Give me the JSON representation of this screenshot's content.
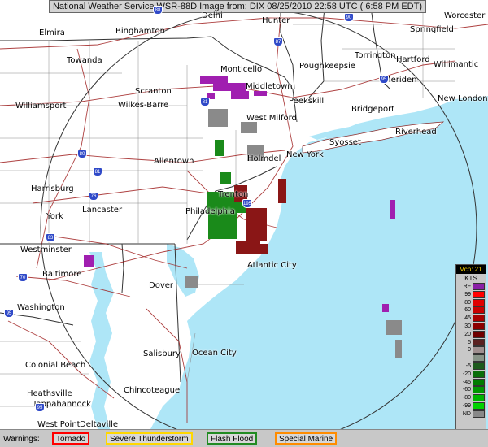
{
  "title": "National Weather Service WSR-88D Image from: DIX 08/25/2010 22:58 UTC ( 6:58 PM EDT)",
  "cities": [
    {
      "id": "elmira",
      "name": "Elmira"
    },
    {
      "id": "binghamton",
      "name": "Binghamton"
    },
    {
      "id": "delhi",
      "name": "Delhi"
    },
    {
      "id": "hunter",
      "name": "Hunter"
    },
    {
      "id": "worcester",
      "name": "Worcester"
    },
    {
      "id": "springfield",
      "name": "Springfield"
    },
    {
      "id": "towanda",
      "name": "Towanda"
    },
    {
      "id": "monticello",
      "name": "Monticello"
    },
    {
      "id": "poughkeepsie",
      "name": "Poughkeepsie"
    },
    {
      "id": "torrington",
      "name": "Torrington"
    },
    {
      "id": "hartford",
      "name": "Hartford"
    },
    {
      "id": "willimantic",
      "name": "Willimantic"
    },
    {
      "id": "middletown",
      "name": "Middletown"
    },
    {
      "id": "meriden",
      "name": "Meriden"
    },
    {
      "id": "scranton",
      "name": "Scranton"
    },
    {
      "id": "wilkesbarre",
      "name": "Wilkes-Barre"
    },
    {
      "id": "peekskill",
      "name": "Peekskill"
    },
    {
      "id": "newlondon",
      "name": "New London"
    },
    {
      "id": "williamsport",
      "name": "Williamsport"
    },
    {
      "id": "bridgeport",
      "name": "Bridgeport"
    },
    {
      "id": "westmilford",
      "name": "West Milford"
    },
    {
      "id": "riverhead",
      "name": "Riverhead"
    },
    {
      "id": "syosset",
      "name": "Syosset"
    },
    {
      "id": "newyork",
      "name": "New York"
    },
    {
      "id": "allentown",
      "name": "Allentown"
    },
    {
      "id": "holmdel",
      "name": "Holmdel"
    },
    {
      "id": "harrisburg",
      "name": "Harrisburg"
    },
    {
      "id": "trenton",
      "name": "Trenton"
    },
    {
      "id": "lancaster",
      "name": "Lancaster"
    },
    {
      "id": "philadelphia",
      "name": "Philadelphia"
    },
    {
      "id": "york",
      "name": "York"
    },
    {
      "id": "westminster",
      "name": "Westminster"
    },
    {
      "id": "atlanticcity",
      "name": "Atlantic City"
    },
    {
      "id": "baltimore",
      "name": "Baltimore"
    },
    {
      "id": "dover",
      "name": "Dover"
    },
    {
      "id": "washington",
      "name": "Washington"
    },
    {
      "id": "salisbury",
      "name": "Salisbury"
    },
    {
      "id": "oceancity",
      "name": "Ocean City"
    },
    {
      "id": "colonialbeach",
      "name": "Colonial Beach"
    },
    {
      "id": "heathsville",
      "name": "Heathsville"
    },
    {
      "id": "tappahannock",
      "name": "Tappahannock"
    },
    {
      "id": "chincoteague",
      "name": "Chincoteague"
    },
    {
      "id": "westpoint",
      "name": "West Point"
    },
    {
      "id": "deltaville",
      "name": "Deltaville"
    }
  ],
  "highways": [
    "88",
    "90",
    "87",
    "81",
    "80",
    "81",
    "76",
    "195",
    "95",
    "83",
    "70",
    "95",
    "95"
  ],
  "legend": {
    "header": "Vcp: 21",
    "unit": "KTS",
    "rows": [
      {
        "label": "RF",
        "color": "#8a1fa6"
      },
      {
        "label": "99",
        "color": "#ff0000"
      },
      {
        "label": "80",
        "color": "#e00000"
      },
      {
        "label": "60",
        "color": "#c80000"
      },
      {
        "label": "45",
        "color": "#a80000"
      },
      {
        "label": "30",
        "color": "#8c0000"
      },
      {
        "label": "20",
        "color": "#700000"
      },
      {
        "label": "5",
        "color": "#5a2020"
      },
      {
        "label": "0",
        "color": "#a09090"
      },
      {
        "label": "",
        "color": "#889488"
      },
      {
        "label": "-5",
        "color": "#1c5a1c"
      },
      {
        "label": "-20",
        "color": "#0a6e0a"
      },
      {
        "label": "-45",
        "color": "#007c00"
      },
      {
        "label": "-60",
        "color": "#009600"
      },
      {
        "label": "-80",
        "color": "#00b400"
      },
      {
        "label": "-99",
        "color": "#00d200"
      },
      {
        "label": "ND",
        "color": "#888888"
      }
    ]
  },
  "warnings": {
    "label": "Warnings:",
    "items": [
      {
        "label": "Tornado",
        "color": "#ff0000"
      },
      {
        "label": "Severe Thunderstorm",
        "color": "#ffd700"
      },
      {
        "label": "Flash Flood",
        "color": "#228b22"
      },
      {
        "label": "Special Marine",
        "color": "#ff8c00"
      }
    ]
  }
}
